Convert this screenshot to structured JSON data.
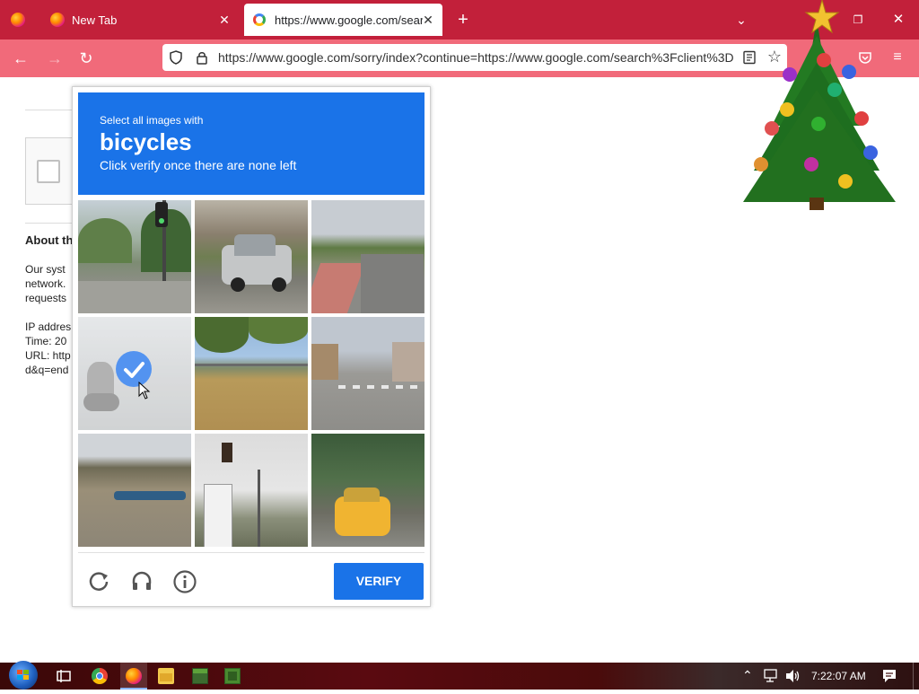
{
  "browser": {
    "tabs": [
      {
        "label": ""
      },
      {
        "label": "New Tab"
      },
      {
        "label": "https://www.google.com/searc"
      }
    ],
    "url": "https://www.google.com/sorry/index?continue=https://www.google.com/search%3Fclient%3D"
  },
  "page": {
    "about_heading": "About th",
    "body_lines": [
      "Our syst",
      "network.",
      "requests"
    ],
    "info_lines": [
      "IP addres",
      "Time: 20",
      "URL: http",
      "d&q=end"
    ]
  },
  "captcha": {
    "instruction_small": "Select all images with",
    "target": "bicycles",
    "instruction_note": "Click verify once there are none left",
    "verify_label": "VERIFY",
    "tiles": [
      {
        "scene": "traffic light intersection",
        "selected": false
      },
      {
        "scene": "silver pickup truck",
        "selected": false
      },
      {
        "scene": "residential street",
        "selected": false
      },
      {
        "scene": "motorcycle rider",
        "selected": true
      },
      {
        "scene": "palm trees",
        "selected": false
      },
      {
        "scene": "street crosswalk",
        "selected": false
      },
      {
        "scene": "beach with boat",
        "selected": false
      },
      {
        "scene": "traffic signal over house",
        "selected": false
      },
      {
        "scene": "yellow taxi",
        "selected": false
      }
    ]
  },
  "taskbar": {
    "clock": "7:22:07 AM"
  },
  "colors": {
    "tabstrip": "#c2203a",
    "navbar": "#f16a7a",
    "captcha_blue": "#1a73e8"
  }
}
